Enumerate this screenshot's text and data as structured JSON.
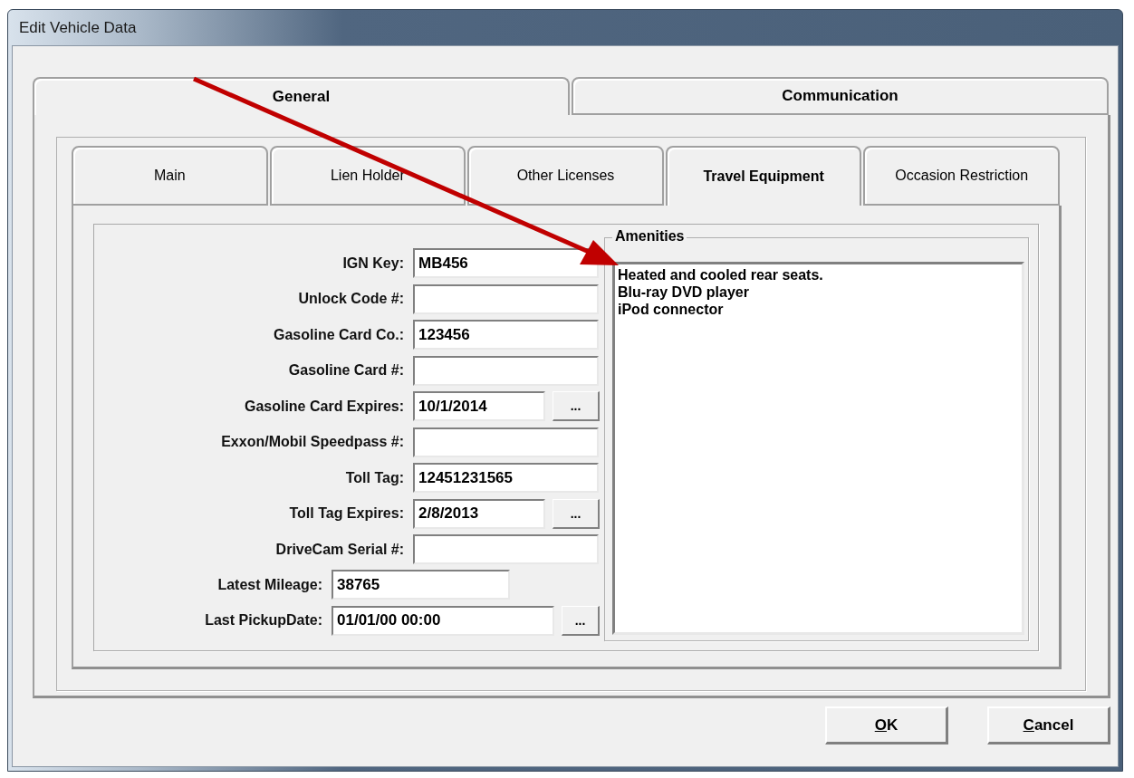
{
  "window": {
    "title": "Edit Vehicle Data"
  },
  "tabs": [
    {
      "label": "General",
      "selected": true
    },
    {
      "label": "Communication",
      "selected": false
    }
  ],
  "subtabs": [
    {
      "label": "Main",
      "selected": false
    },
    {
      "label": "Lien Holder",
      "selected": false
    },
    {
      "label": "Other Licenses",
      "selected": false
    },
    {
      "label": "Travel Equipment",
      "selected": true
    },
    {
      "label": "Occasion Restriction",
      "selected": false
    }
  ],
  "fields": [
    {
      "kind": "text",
      "label": "IGN Key:",
      "value": "MB456"
    },
    {
      "kind": "text",
      "label": "Unlock Code #:"
    },
    {
      "kind": "text",
      "label": "Gasoline Card Co.:",
      "value": "123456"
    },
    {
      "kind": "text",
      "label": "Gasoline Card #:"
    },
    {
      "kind": "date",
      "label": "Gasoline Card Expires:",
      "value": "10/1/2014",
      "button": "..."
    },
    {
      "kind": "text",
      "label": "Exxon/Mobil Speedpass #:"
    },
    {
      "kind": "text",
      "label": "Toll Tag:",
      "value": "12451231565"
    },
    {
      "kind": "date",
      "label": "Toll Tag Expires:",
      "value": "2/8/2013",
      "button": "..."
    },
    {
      "kind": "text",
      "label": "DriveCam Serial #:"
    }
  ],
  "footer_fields": [
    {
      "kind": "text",
      "label": "Latest Mileage:",
      "value": "38765"
    },
    {
      "kind": "date",
      "label": "Last PickupDate:",
      "value": "01/01/00 00:00",
      "button": "..."
    }
  ],
  "amenities": {
    "title": "Amenities",
    "value": "Heated and cooled rear seats.\nBlu-ray DVD player\niPod connector"
  },
  "buttons": [
    {
      "label": "OK",
      "mnemonic_first": true
    },
    {
      "label": "Cancel",
      "mnemonic_first": true
    }
  ],
  "annotation": {
    "kind": "arrow"
  }
}
